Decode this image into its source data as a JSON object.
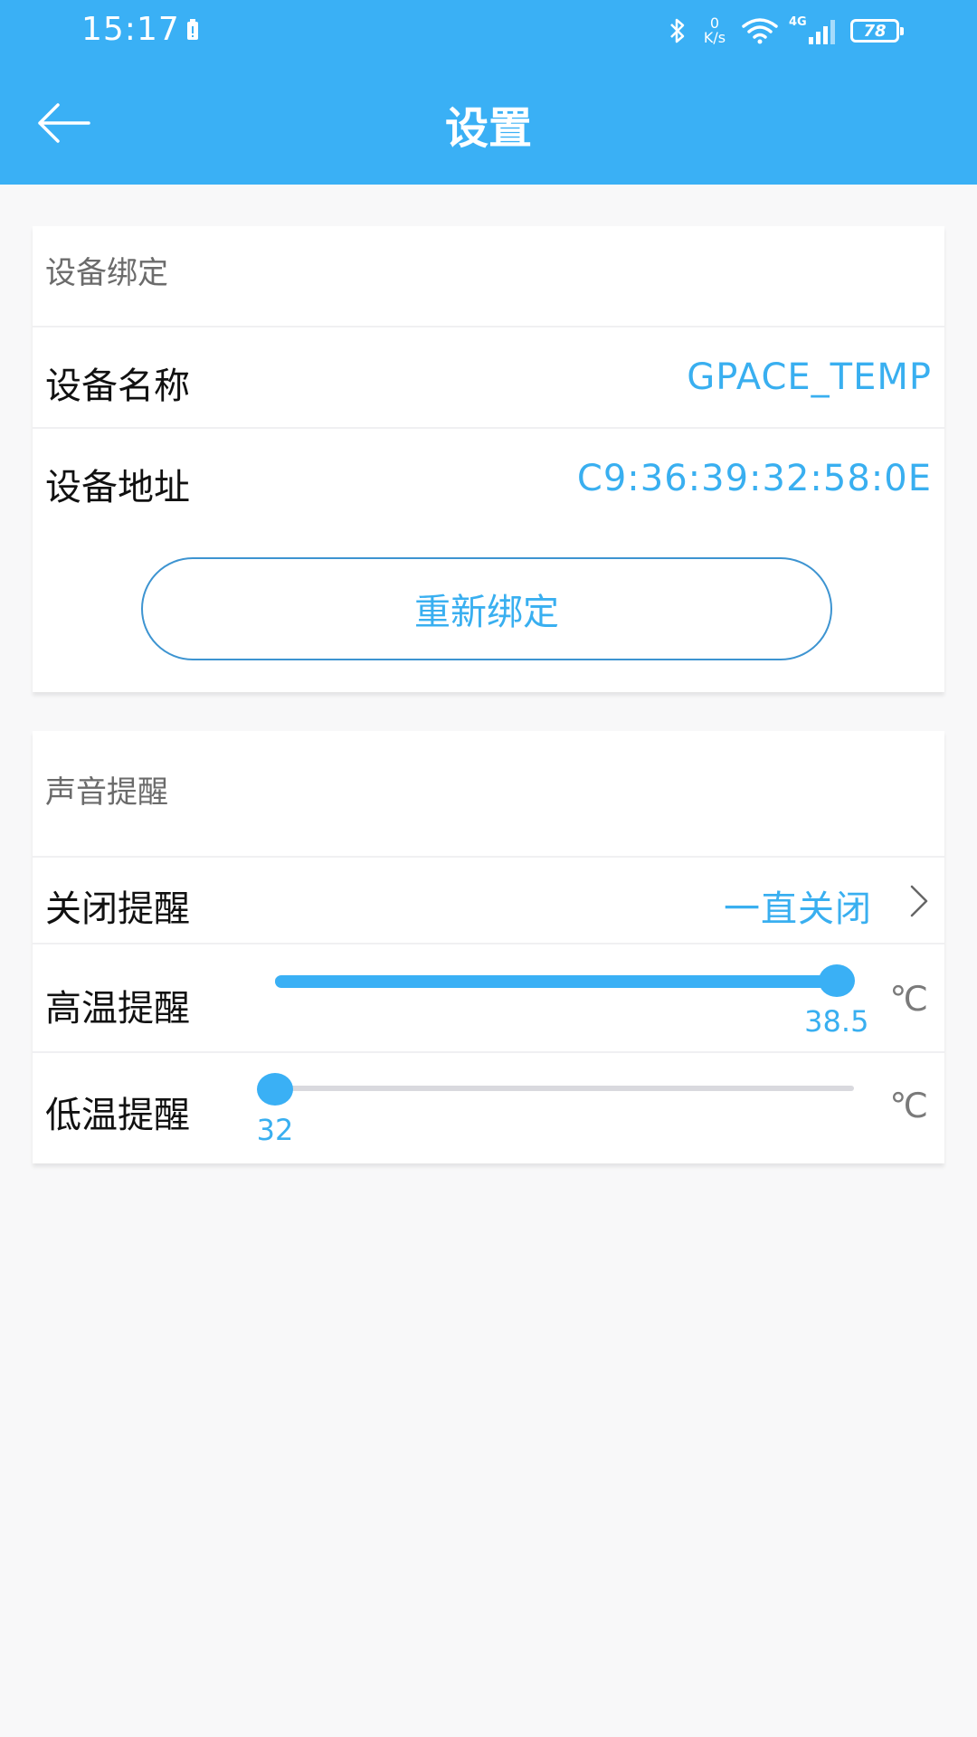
{
  "status_bar": {
    "time": "15:17",
    "net_speed_value": "0",
    "net_speed_unit": "K/s",
    "network_type": "4G",
    "battery_level": "78"
  },
  "header": {
    "title": "设置"
  },
  "binding_section": {
    "title": "设备绑定",
    "device_name_label": "设备名称",
    "device_name_value": "GPACE_TEMP",
    "device_address_label": "设备地址",
    "device_address_value": "C9:36:39:32:58:0E",
    "rebind_label": "重新绑定"
  },
  "alert_section": {
    "title": "声音提醒",
    "close_alert_label": "关闭提醒",
    "close_alert_value": "一直关闭",
    "high_temp": {
      "label": "高温提醒",
      "value": "38.5",
      "fraction": 0.97,
      "unit": "℃"
    },
    "low_temp": {
      "label": "低温提醒",
      "value": "32",
      "fraction": 0.0,
      "unit": "℃"
    }
  },
  "colors": {
    "accent": "#3ab0f5",
    "value_text": "#39aff0",
    "background": "#f8f8f9"
  },
  "icons": {
    "back": "arrow-left-icon",
    "chevron": "chevron-right-icon",
    "bluetooth": "bluetooth-icon",
    "wifi": "wifi-icon",
    "signal": "signal-icon",
    "battery": "battery-icon"
  }
}
